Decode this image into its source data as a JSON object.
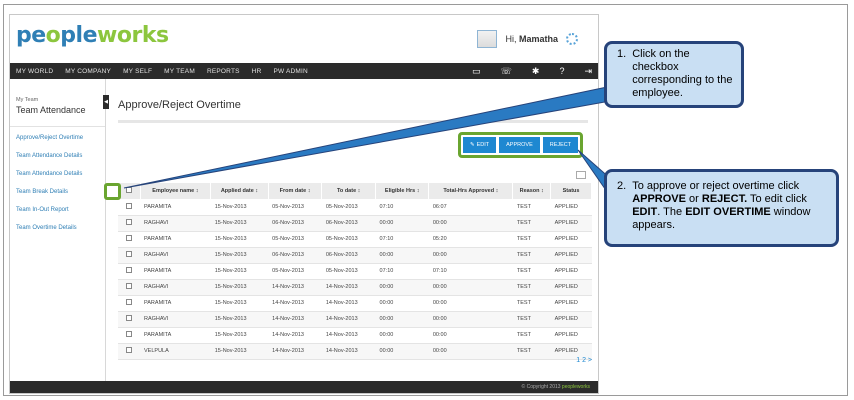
{
  "app": {
    "logo_part1": "pe",
    "logo_part2": "o",
    "logo_part3": "ple",
    "logo_part4": "w",
    "logo_part5": "o",
    "logo_part6": "rks",
    "greeting_prefix": "Hi,",
    "user_name": "Mamatha"
  },
  "nav": {
    "items": [
      "MY WORLD",
      "MY COMPANY",
      "MY SELF",
      "MY TEAM",
      "REPORTS",
      "HR",
      "PW ADMIN"
    ],
    "icons": [
      "book-icon",
      "phone-icon",
      "tools-icon",
      "help-icon",
      "logout-icon"
    ]
  },
  "sidebar": {
    "section_small": "My Team",
    "section_title": "Team Attendance",
    "items": [
      "Approve/Reject Overtime",
      "Team Attendance Details",
      "Team Attendance Details",
      "Team Break Details",
      "Team In-Out Report",
      "Team Overtime Details"
    ]
  },
  "main": {
    "page_title": "Approve/Reject Overtime",
    "buttons": {
      "edit": "EDIT",
      "approve": "APPROVE",
      "reject": "REJECT"
    },
    "table": {
      "headers": [
        "",
        "Employee name ↕",
        "Applied date ↕",
        "From date ↕",
        "To date ↕",
        "Eligible Hrs ↕",
        "Total-Hrs Approved ↕",
        "Reason ↕",
        "Status"
      ],
      "rows": [
        [
          "PARAMITA",
          "15-Nov-2013",
          "05-Nov-2013",
          "05-Nov-2013",
          "07:10",
          "06:07",
          "TEST",
          "APPLIED"
        ],
        [
          "RAGHAVI",
          "15-Nov-2013",
          "06-Nov-2013",
          "06-Nov-2013",
          "00:00",
          "00:00",
          "TEST",
          "APPLIED"
        ],
        [
          "PARAMITA",
          "15-Nov-2013",
          "05-Nov-2013",
          "05-Nov-2013",
          "07:10",
          "05:20",
          "TEST",
          "APPLIED"
        ],
        [
          "RAGHAVI",
          "15-Nov-2013",
          "06-Nov-2013",
          "06-Nov-2013",
          "00:00",
          "00:00",
          "TEST",
          "APPLIED"
        ],
        [
          "PARAMITA",
          "15-Nov-2013",
          "05-Nov-2013",
          "05-Nov-2013",
          "07:10",
          "07:10",
          "TEST",
          "APPLIED"
        ],
        [
          "RAGHAVI",
          "15-Nov-2013",
          "14-Nov-2013",
          "14-Nov-2013",
          "00:00",
          "00:00",
          "TEST",
          "APPLIED"
        ],
        [
          "PARAMITA",
          "15-Nov-2013",
          "14-Nov-2013",
          "14-Nov-2013",
          "00:00",
          "00:00",
          "TEST",
          "APPLIED"
        ],
        [
          "RAGHAVI",
          "15-Nov-2013",
          "14-Nov-2013",
          "14-Nov-2013",
          "00:00",
          "00:00",
          "TEST",
          "APPLIED"
        ],
        [
          "PARAMITA",
          "15-Nov-2013",
          "14-Nov-2013",
          "14-Nov-2013",
          "00:00",
          "00:00",
          "TEST",
          "APPLIED"
        ],
        [
          "VELPULA",
          "15-Nov-2013",
          "14-Nov-2013",
          "14-Nov-2013",
          "00:00",
          "00:00",
          "TEST",
          "APPLIED"
        ]
      ]
    },
    "pager": "1 2 >"
  },
  "footer": {
    "copyright": "© Copyright 2013",
    "brand": "peopleworks"
  },
  "callouts": {
    "one": {
      "number": "1.",
      "text": "Click on the checkbox corresponding to the employee."
    },
    "two": {
      "number": "2.",
      "t1": "To approve or reject overtime click ",
      "b1": "APPROVE",
      "t2": " or ",
      "b2": "REJECT.",
      "t3": " To edit click ",
      "b3": "EDIT",
      "t4": ". The ",
      "b4": "EDIT OVERTIME",
      "t5": " window appears."
    }
  },
  "colors": {
    "accent_blue": "#1e88d1",
    "highlight_green": "#6aa530",
    "callout_fill": "#c9dff3",
    "callout_border": "#26437a",
    "nav_dark": "#2b2b2b"
  }
}
